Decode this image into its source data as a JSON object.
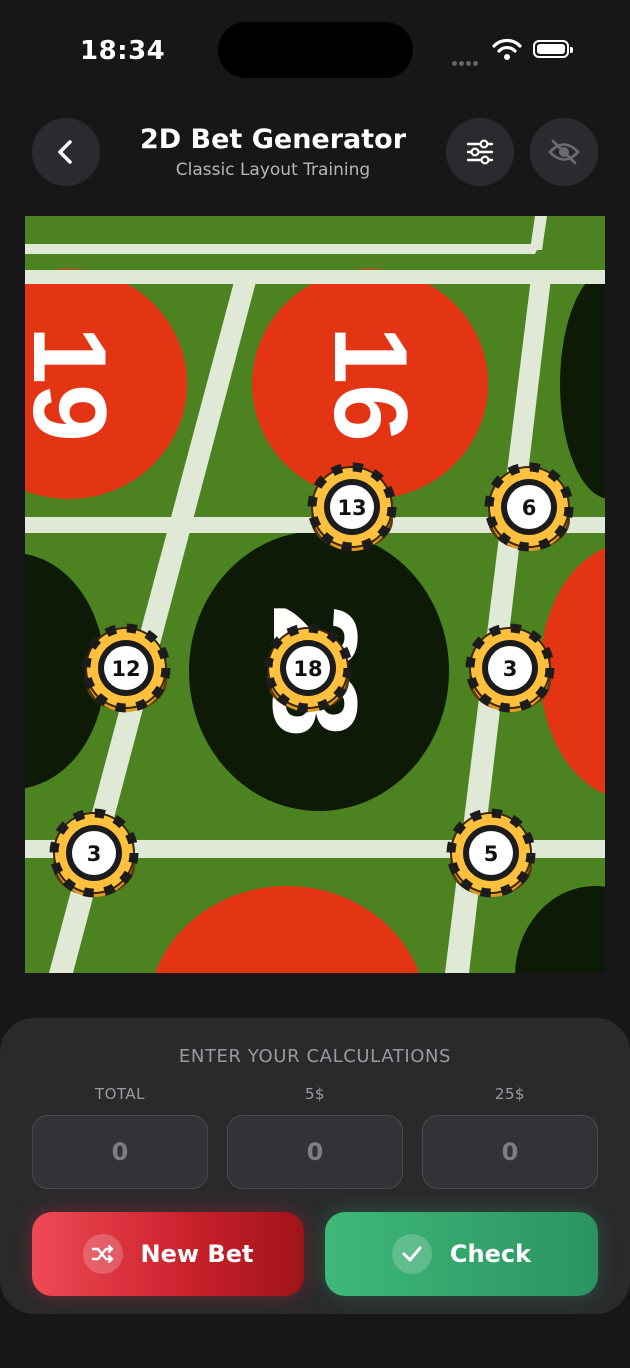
{
  "status_bar": {
    "time": "18:34"
  },
  "header": {
    "title": "2D Bet Generator",
    "subtitle": "Classic Layout Training",
    "icons": {
      "back": "chevron-left-icon",
      "settings": "sliders-icon",
      "visibility": "eye-slash-icon"
    }
  },
  "table": {
    "colors": {
      "felt": "#4c8320",
      "red": "#e33414",
      "black": "#0c1a06",
      "line": "#dfe9d6"
    },
    "numbers": [
      "19",
      "16",
      "23"
    ],
    "chips": [
      "13",
      "6",
      "12",
      "18",
      "3",
      "3",
      "5"
    ]
  },
  "calc": {
    "title": "ENTER YOUR CALCULATIONS",
    "fields": [
      {
        "label": "TOTAL",
        "value": "0"
      },
      {
        "label": "5$",
        "value": "0"
      },
      {
        "label": "25$",
        "value": "0"
      }
    ]
  },
  "actions": {
    "new_bet": {
      "label": "New Bet",
      "icon": "shuffle-icon",
      "color": "#e3333e"
    },
    "check": {
      "label": "Check",
      "icon": "checkmark-icon",
      "color": "#33a56c"
    }
  }
}
